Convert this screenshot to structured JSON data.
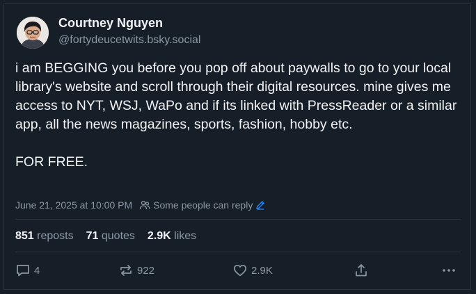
{
  "post": {
    "author_name": "Courtney Nguyen",
    "author_handle": "@fortydeucetwits.bsky.social",
    "text": "i am BEGGING you before you pop off about paywalls to go to your local library's website and scroll through their digital resources. mine gives me access to NYT, WSJ, WaPo and if its linked with PressReader or a similar app, all the news magazines, sports, fashion, hobby etc.\n\nFOR FREE.",
    "timestamp": "June 21, 2025 at 10:00 PM",
    "reply_setting": "Some people can reply"
  },
  "stats": {
    "reposts_count": "851",
    "reposts_label": "reposts",
    "quotes_count": "71",
    "quotes_label": "quotes",
    "likes_count": "2.9K",
    "likes_label": "likes"
  },
  "actions": {
    "reply_count": "4",
    "repost_count": "922",
    "like_count": "2.9K"
  },
  "icons": {
    "reply": "speech-bubble-icon",
    "repost": "repost-arrows-icon",
    "like": "heart-icon",
    "share": "share-icon",
    "more": "more-dots-icon",
    "people": "people-icon",
    "edit": "pencil-icon"
  },
  "colors": {
    "background": "#161e27",
    "text": "#f1f3f5",
    "muted": "#8b98a5",
    "accent": "#208bfe",
    "divider": "#2a3541"
  }
}
